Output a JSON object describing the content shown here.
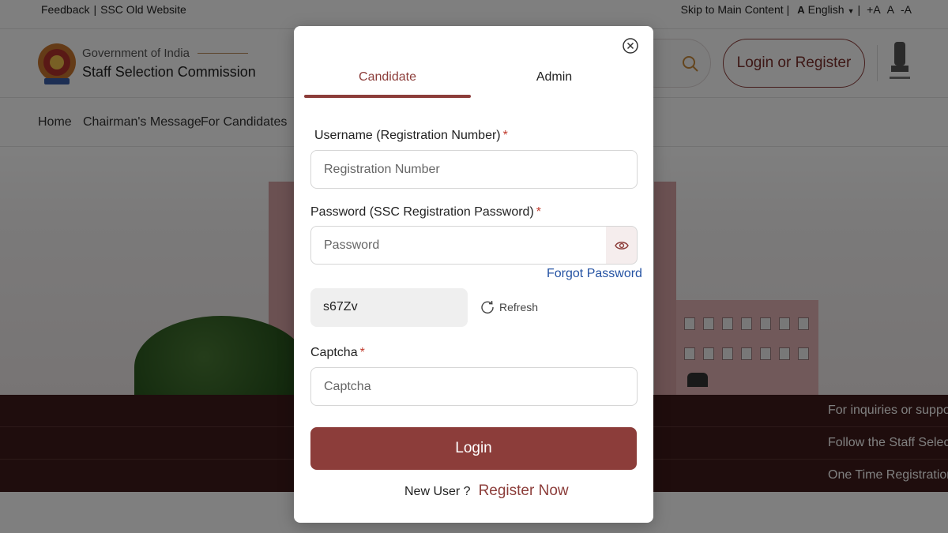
{
  "topbar": {
    "feedback": "Feedback",
    "old_website": "SSC Old Website",
    "skip": "Skip to Main Content",
    "lang_icon": "A",
    "language": "English",
    "font_increase": "+A",
    "font_normal": "A",
    "font_decrease": "-A"
  },
  "header": {
    "gov": "Government of India",
    "org": "Staff Selection Commission",
    "login_register": "Login or Register"
  },
  "nav": {
    "home": "Home",
    "chairman": "Chairman's Message",
    "candidates": "For Candidates"
  },
  "ticker": [
    "For inquiries or suppo",
    "Follow the Staff Selec",
    "One Time Registration"
  ],
  "modal": {
    "tabs": {
      "candidate": "Candidate",
      "admin": "Admin"
    },
    "username": {
      "label": "Username (Registration Number)",
      "placeholder": "Registration Number"
    },
    "password": {
      "label": "Password (SSC Registration Password)",
      "placeholder": "Password"
    },
    "forgot": "Forgot Password",
    "captcha_code": "s67Zv",
    "refresh": "Refresh",
    "captcha": {
      "label": "Captcha",
      "placeholder": "Captcha"
    },
    "required_mark": "*",
    "login": "Login",
    "new_user": "New User ?",
    "register": "Register Now"
  },
  "colors": {
    "accent": "#8c3d3a",
    "link": "#2553a3",
    "ticker_bg": "#3f1b1a"
  }
}
